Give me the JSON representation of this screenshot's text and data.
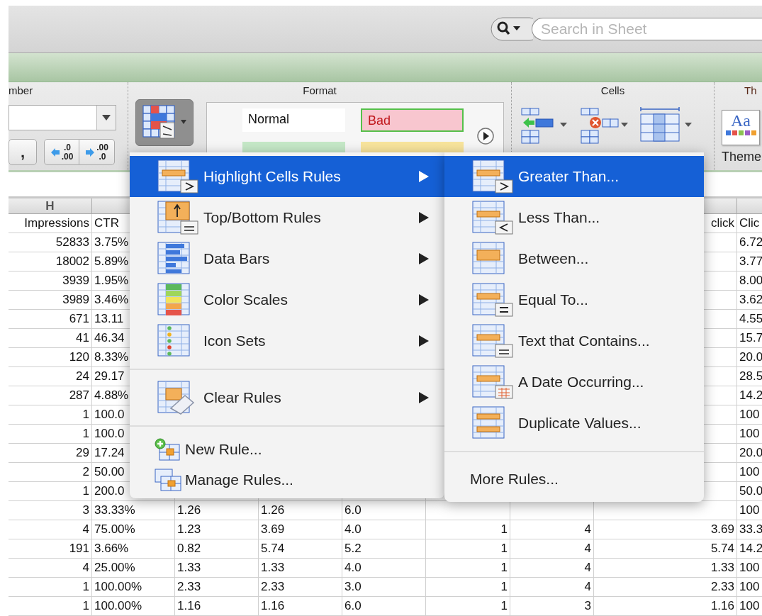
{
  "search": {
    "placeholder": "Search in Sheet"
  },
  "ribbon": {
    "group_titles": [
      "mber",
      "Format",
      "Cells",
      "Th"
    ],
    "number": {
      "comma": ",",
      "decrease_decimal": [
        ".0",
        ".00"
      ],
      "increase_decimal": [
        ".00",
        ".0"
      ]
    },
    "conditional_formatting": {
      "selected": true
    },
    "styles": [
      {
        "kind": "normal",
        "label": "Normal"
      },
      {
        "kind": "bad",
        "label": "Bad"
      },
      {
        "kind": "good"
      },
      {
        "kind": "neutral"
      }
    ],
    "themes": {
      "icon_text": "Aa",
      "label": "Theme"
    }
  },
  "sheet": {
    "column_headers": [
      "H"
    ],
    "rows": [
      [
        "Impressions",
        "CTR",
        null,
        null,
        null,
        null,
        null,
        "click",
        "Clic"
      ],
      [
        "52833",
        "3.75%",
        null,
        null,
        null,
        null,
        null,
        null,
        "6.72"
      ],
      [
        "18002",
        "5.89%",
        null,
        null,
        null,
        null,
        null,
        null,
        "3.77"
      ],
      [
        "3939",
        "1.95%",
        null,
        null,
        null,
        null,
        null,
        null,
        "8.00"
      ],
      [
        "3989",
        "3.46%",
        null,
        null,
        null,
        null,
        null,
        null,
        "3.62"
      ],
      [
        "671",
        "13.11",
        null,
        null,
        null,
        null,
        null,
        null,
        "4.55"
      ],
      [
        "41",
        "46.34",
        null,
        null,
        null,
        null,
        null,
        null,
        "15.7"
      ],
      [
        "120",
        "8.33%",
        null,
        null,
        null,
        null,
        null,
        null,
        "20.0"
      ],
      [
        "24",
        "29.17",
        null,
        null,
        null,
        null,
        null,
        null,
        "28.5"
      ],
      [
        "287",
        "4.88%",
        null,
        null,
        null,
        null,
        null,
        null,
        "14.2"
      ],
      [
        "1",
        "100.0",
        null,
        null,
        null,
        null,
        null,
        null,
        "100"
      ],
      [
        "1",
        "100.0",
        null,
        null,
        null,
        null,
        null,
        null,
        "100"
      ],
      [
        "29",
        "17.24",
        null,
        null,
        null,
        null,
        null,
        null,
        "20.0"
      ],
      [
        "2",
        "50.00",
        null,
        null,
        null,
        null,
        null,
        null,
        "100"
      ],
      [
        "1",
        "200.0",
        null,
        null,
        null,
        null,
        null,
        null,
        "50.0"
      ],
      [
        "3",
        "33.33%",
        "1.26",
        "1.26",
        "6.0",
        null,
        null,
        null,
        "100"
      ],
      [
        "4",
        "75.00%",
        "1.23",
        "3.69",
        "4.0",
        "1",
        "4",
        "3.69",
        "33.3"
      ],
      [
        "191",
        "3.66%",
        "0.82",
        "5.74",
        "5.2",
        "1",
        "4",
        "5.74",
        "14.2"
      ],
      [
        "4",
        "25.00%",
        "1.33",
        "1.33",
        "4.0",
        "1",
        "4",
        "1.33",
        "100"
      ],
      [
        "1",
        "100.00%",
        "2.33",
        "2.33",
        "3.0",
        "1",
        "4",
        "2.33",
        "100"
      ],
      [
        "1",
        "100.00%",
        "1.16",
        "1.16",
        "6.0",
        "1",
        "3",
        "1.16",
        "100"
      ]
    ]
  },
  "menu": {
    "items": [
      {
        "kind": "item",
        "label": "Highlight Cells Rules",
        "has_submenu": true,
        "selected": true
      },
      {
        "kind": "item",
        "label": "Top/Bottom Rules",
        "has_submenu": true,
        "selected": false
      },
      {
        "kind": "item",
        "label": "Data Bars",
        "has_submenu": true,
        "selected": false
      },
      {
        "kind": "item",
        "label": "Color Scales",
        "has_submenu": true,
        "selected": false
      },
      {
        "kind": "item",
        "label": "Icon Sets",
        "has_submenu": true,
        "selected": false
      },
      {
        "kind": "separator"
      },
      {
        "kind": "item",
        "label": "Clear Rules",
        "has_submenu": true,
        "selected": false
      },
      {
        "kind": "separator"
      },
      {
        "kind": "small",
        "label": "New Rule...",
        "has_submenu": false,
        "selected": false
      },
      {
        "kind": "small",
        "label": "Manage Rules...",
        "has_submenu": false,
        "selected": false
      }
    ]
  },
  "submenu": {
    "items": [
      {
        "kind": "item",
        "label": "Greater Than...",
        "selected": true
      },
      {
        "kind": "item",
        "label": "Less Than...",
        "selected": false
      },
      {
        "kind": "item",
        "label": "Between...",
        "selected": false
      },
      {
        "kind": "item",
        "label": "Equal To...",
        "selected": false
      },
      {
        "kind": "item",
        "label": "Text that Contains...",
        "selected": false
      },
      {
        "kind": "item",
        "label": "A Date Occurring...",
        "selected": false
      },
      {
        "kind": "item",
        "label": "Duplicate Values...",
        "selected": false
      },
      {
        "kind": "separator"
      },
      {
        "kind": "text",
        "label": "More Rules...",
        "selected": false
      }
    ]
  }
}
